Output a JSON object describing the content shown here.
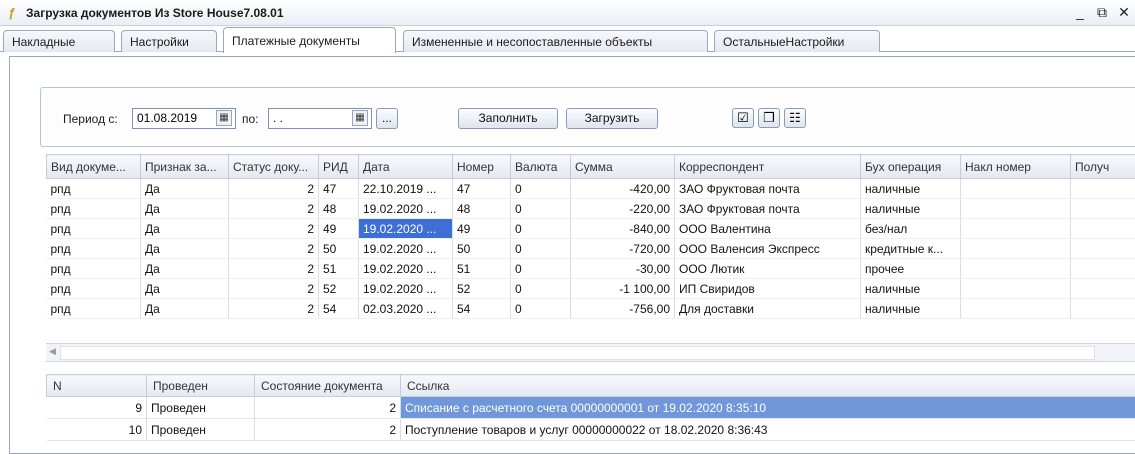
{
  "window": {
    "title": "Загрузка документов Из Store House7.08.01",
    "controls": [
      "_",
      "⧉",
      "✕"
    ]
  },
  "tabs": [
    {
      "label": "Накладные",
      "active": false
    },
    {
      "label": "Настройки",
      "active": false
    },
    {
      "label": "Платежные документы",
      "active": true
    },
    {
      "label": "Измененные и несопоставленные объекты",
      "active": false
    },
    {
      "label": "ОстальныеНастройки",
      "active": false
    }
  ],
  "period": {
    "from_label": "Период с:",
    "from_value": "01.08.2019",
    "to_label": "по:",
    "to_value": " .  .",
    "ellipsis_label": "...",
    "fill_label": "Заполнить",
    "load_label": "Загрузить"
  },
  "main_table": {
    "columns": [
      "Вид докуме...",
      "Признак за...",
      "Статус доку...",
      "РИД",
      "Дата",
      "Номер",
      "Валюта",
      "Сумма",
      "Корреспондент",
      "Бух операция",
      "Накл номер",
      "Получ"
    ],
    "rows": [
      [
        "рпд",
        "Да",
        "2",
        "47",
        "22.10.2019 ...",
        "47",
        "0",
        "-420,00",
        "ЗАО Фруктовая почта",
        "наличные",
        "",
        ""
      ],
      [
        "рпд",
        "Да",
        "2",
        "48",
        "19.02.2020 ...",
        "48",
        "0",
        "-220,00",
        "ЗАО Фруктовая почта",
        "наличные",
        "",
        ""
      ],
      [
        "рпд",
        "Да",
        "2",
        "49",
        "19.02.2020 ...",
        "49",
        "0",
        "-840,00",
        "ООО Валентина",
        "без/нал",
        "",
        ""
      ],
      [
        "рпд",
        "Да",
        "2",
        "50",
        "19.02.2020 ...",
        "50",
        "0",
        "-720,00",
        "ООО Валенсия Экспресс",
        "кредитные к...",
        "",
        ""
      ],
      [
        "рпд",
        "Да",
        "2",
        "51",
        "19.02.2020 ...",
        "51",
        "0",
        "-30,00",
        "ООО Лютик",
        "прочее",
        "",
        ""
      ],
      [
        "рпд",
        "Да",
        "2",
        "52",
        "19.02.2020 ...",
        "52",
        "0",
        "-1 100,00",
        "ИП Свиридов",
        "наличные",
        "",
        ""
      ],
      [
        "рпд",
        "Да",
        "2",
        "54",
        "02.03.2020 ...",
        "54",
        "0",
        "-756,00",
        "Для доставки",
        "наличные",
        "",
        ""
      ]
    ]
  },
  "bottom_table": {
    "columns": [
      "N",
      "Проведен",
      "Состояние документа",
      "Ссылка"
    ],
    "rows": [
      [
        "9",
        "Проведен",
        "2",
        "Списание с расчетного счета 00000000001 от 19.02.2020 8:35:10"
      ],
      [
        "10",
        "Проведен",
        "2",
        "Поступление товаров и услуг 00000000022 от 18.02.2020 8:36:43"
      ]
    ]
  },
  "colors": {
    "selection": "#3d6fd6",
    "link_selection": "#6f97d9",
    "border": "#9aa8bc"
  }
}
